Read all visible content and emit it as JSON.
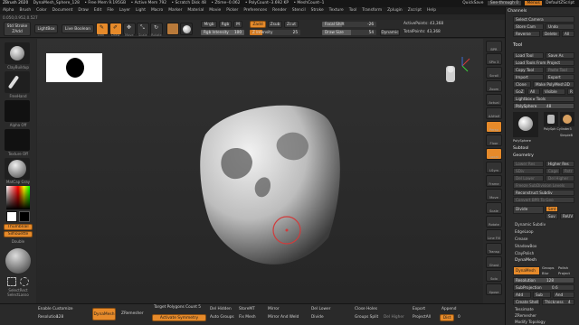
{
  "titlebar": {
    "app": "ZBrush 2020",
    "doc": "DynaMesh_Sphere_128",
    "free_mem": "• Free Mem 9.195GB",
    "active_mem": "• Active Mem 792",
    "scratch": "• Scratch Disk 48",
    "ztime": "• Ztime┈0.062",
    "polycount": "• PolyCount┈3.692 KP",
    "meshcount": "• MeshCount┈1",
    "quicksave": "QuickSave",
    "seethrough": "See-through  0",
    "menus": "Menus",
    "script": "DefaultZScript"
  },
  "menus": [
    "Alpha",
    "Brush",
    "Color",
    "Document",
    "Draw",
    "Edit",
    "File",
    "Layer",
    "Light",
    "Macro",
    "Marker",
    "Material",
    "Movie",
    "Picker",
    "Preferences",
    "Render",
    "Stencil",
    "Stroke",
    "Texture",
    "Tool",
    "Transform",
    "Zplugin",
    "Zscript",
    "Help"
  ],
  "coords": "0.050,0.952,0.527",
  "topshelf": {
    "brush_name": "Std Stroke",
    "brush_sub": "ZAdd",
    "lightbox": "LightBox",
    "live_boolean": "Live Boolean",
    "edit": "Edit",
    "draw": "Draw",
    "move": "Move",
    "scale": "Scale",
    "rotate": "Rotate",
    "mrgb": "Mrgb",
    "rgb": "Rgb",
    "m": "M",
    "zadd": "Zadd",
    "zsub": "Zsub",
    "zcut": "Zcut",
    "rgb_intensity_label": "Rgb Intensity",
    "rgb_intensity": "100",
    "z_intensity_label": "Z Intensity",
    "z_intensity": "25",
    "focal_label": "Focal Shift",
    "focal": "-26",
    "drawsize_label": "Draw Size",
    "drawsize": "54",
    "dynamic": "Dynamic",
    "activepoints": "ActivePoints: 43,368",
    "totalpoints": "TotalPoints: 43,368"
  },
  "left": {
    "brush": "ClayBuildup",
    "stroke": "FreeHand",
    "alpha": "Alpha Off",
    "texture": "Texture Off",
    "material": "MatCap Gray",
    "gradient": "Gradient",
    "switch": "SwitchColor",
    "alternate": "Alternate",
    "thumbnail": "Thumbnail",
    "silhouette": "Silhouette",
    "double": "Double",
    "selectrect": "SelectRect",
    "selectlasso": "SelectLasso"
  },
  "right_shelf": [
    "BPR",
    "SPix 3",
    "Scroll",
    "Zoom",
    "Actual",
    "AAHalf",
    "Persp",
    "Floor",
    "Local",
    "LSym",
    "Frame",
    "Move",
    "Scale",
    "Rotate",
    "Line Fill",
    "Transp",
    "Ghost",
    "Solo",
    "Xpose"
  ],
  "panel": {
    "channels": "Channels",
    "select_camera": "Select Camera",
    "store_cam": "Store Cam",
    "undo": "Undo",
    "reverse": "Reverse",
    "delete": "Delete",
    "all": "All",
    "tool": "Tool",
    "load_tool": "Load Tool",
    "save_as": "Save As",
    "load_project": "Load Tools From Project",
    "copy_tool": "Copy Tool",
    "paste_tool": "Paste Tool",
    "import": "Import",
    "export": "Export",
    "clone": "Clone",
    "make_polymesh": "Make PolyMesh3D",
    "goz": "GoZ",
    "all2": "All",
    "visible": "Visible",
    "r": "R",
    "lightbox_tools": "Lightbox ▸ Tools",
    "polysphere_label": "PolySphere",
    "polysphere_val": "48",
    "thumb1": "PolySphere",
    "thumb2": "PolySph Cylinder3",
    "thumb3": "SimpleB",
    "subtool": "Subtool",
    "geometry": "Geometry",
    "lower_res": "Lower Res",
    "higher_res": "Higher Res",
    "sdiv": "SDiv",
    "cage": "Cage",
    "rstr": "Rstr",
    "del_lower": "Del Lower",
    "del_higher": "Del Higher",
    "freeze": "Freeze SubDivision Levels",
    "reconstruct": "Reconstruct Subdiv",
    "convert_bpr": "Convert BPR To Geo",
    "divide": "Divide",
    "smt": "Smt",
    "suv": "Suv",
    "rsmt": "ReUV",
    "dynamic_subdiv": "Dynamic Subdiv",
    "edgeloop": "EdgeLoop",
    "crease": "Crease",
    "shadowbox": "ShadowBox",
    "claypolish": "ClayPolish",
    "dynamesh_section": "DynaMesh",
    "dynamesh": "DynaMesh",
    "groups": "Groups",
    "polish": "Polish",
    "blur": "Blur",
    "project": "Project",
    "resolution_label": "Resolution",
    "resolution": "128",
    "subproj_label": "SubProjection",
    "subproj": "0.6",
    "add": "Add",
    "sub": "Sub",
    "and": "And",
    "create_shell": "Create Shell",
    "thickness_label": "Thickness",
    "thickness": "4",
    "tessimate": "Tessimate",
    "zremesher": "ZRemesher",
    "modify_topology": "Modify Topology"
  },
  "bottom": {
    "enable_customize": "Enable Customize",
    "resolution_label": "Resolution",
    "resolution": "128",
    "dynamesh": "DynaMesh",
    "zremesher": "ZRemesher",
    "target_poly": "Target Polygons Count",
    "target_poly_val": "5",
    "activate_symmetry": "Activate Symmetry",
    "del_hidden": "Del Hidden",
    "auto_groups": "Auto Groups",
    "store_mt": "StoreMT",
    "fix_mesh": "Fix Mesh",
    "mirror": "Mirror",
    "mirror_weld": "Mirror And Weld",
    "del_lower": "Del Lower",
    "divide": "Divide",
    "close_holes": "Close Holes",
    "groups_split": "Groups Split",
    "del_higher": "Del Higher",
    "project_all": "ProjectAll",
    "export": "Export",
    "append": "Append",
    "dist": "Dist",
    "dist_val": "0"
  }
}
